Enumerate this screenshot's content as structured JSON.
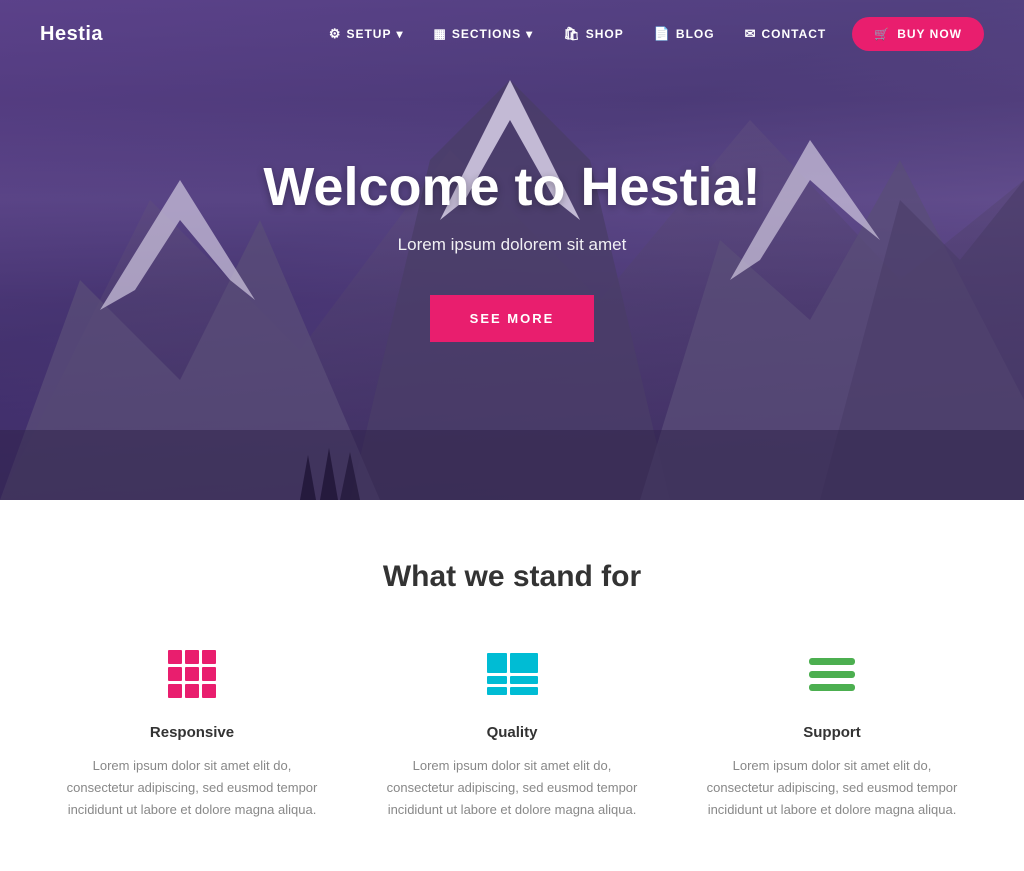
{
  "navbar": {
    "brand": "Hestia",
    "nav_items": [
      {
        "label": "SETUP",
        "icon": "⚙",
        "has_dropdown": true,
        "id": "setup"
      },
      {
        "label": "SECTIONS",
        "icon": "▦",
        "has_dropdown": true,
        "id": "sections"
      },
      {
        "label": "SHOP",
        "icon": "🛍",
        "has_dropdown": false,
        "id": "shop"
      },
      {
        "label": "BLOG",
        "icon": "📄",
        "has_dropdown": false,
        "id": "blog"
      },
      {
        "label": "CONTACT",
        "icon": "✉",
        "has_dropdown": false,
        "id": "contact"
      }
    ],
    "buy_button": "BUY NOW",
    "buy_icon": "🛒"
  },
  "hero": {
    "title": "Welcome to Hestia!",
    "subtitle": "Lorem ipsum dolorem sit amet",
    "cta_label": "SEE MORE"
  },
  "features": {
    "section_title": "What we stand for",
    "items": [
      {
        "id": "responsive",
        "name": "Responsive",
        "icon_type": "grid",
        "description": "Lorem ipsum dolor sit amet elit do, consectetur adipiscing, sed eusmod tempor incididunt ut labore et dolore magna aliqua."
      },
      {
        "id": "quality",
        "name": "Quality",
        "icon_type": "table",
        "description": "Lorem ipsum dolor sit amet elit do, consectetur adipiscing, sed eusmod tempor incididunt ut labore et dolore magna aliqua."
      },
      {
        "id": "support",
        "name": "Support",
        "icon_type": "lines",
        "description": "Lorem ipsum dolor sit amet elit do, consectetur adipiscing, sed eusmod tempor incididunt ut labore et dolore magna aliqua."
      }
    ]
  },
  "colors": {
    "brand_pink": "#e91e6e",
    "brand_teal": "#00bcd4",
    "brand_green": "#4caf50",
    "text_dark": "#333333",
    "text_light": "#888888"
  }
}
